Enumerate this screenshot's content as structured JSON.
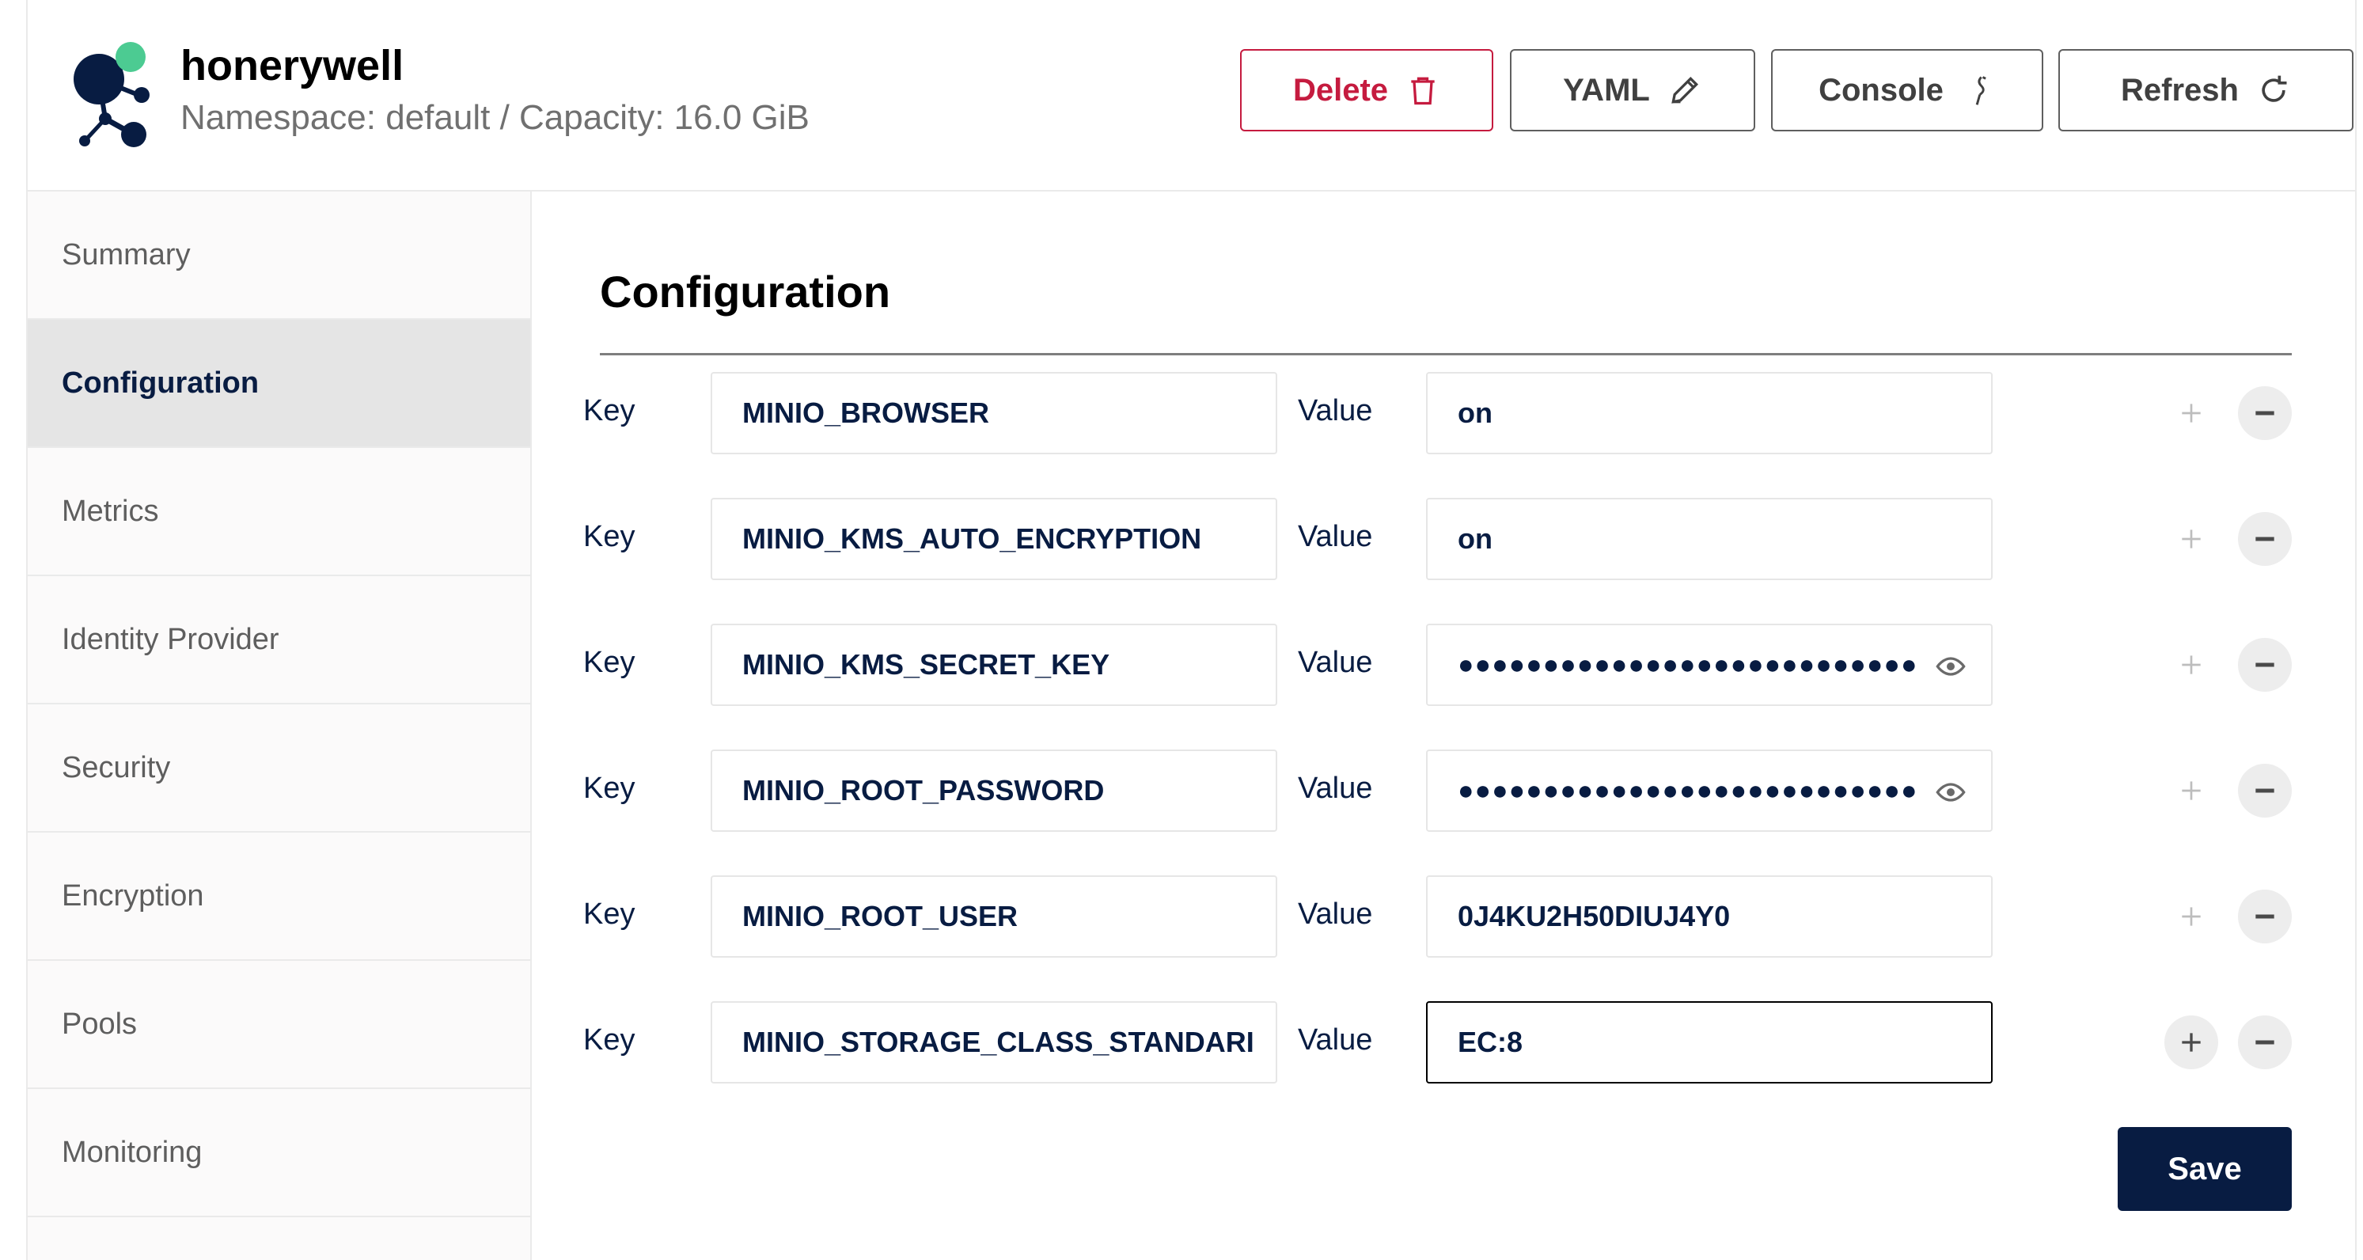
{
  "header": {
    "tenant_name": "honerywell",
    "subtitle": "Namespace: default / Capacity: 16.0 GiB",
    "buttons": {
      "delete": "Delete",
      "yaml": "YAML",
      "console": "Console",
      "refresh": "Refresh"
    }
  },
  "colors": {
    "primary": "#081c42",
    "danger": "#c51b3f",
    "logo_dark": "#081c42",
    "logo_green": "#4ccb92"
  },
  "sidebar": {
    "items": [
      {
        "label": "Summary",
        "active": false
      },
      {
        "label": "Configuration",
        "active": true
      },
      {
        "label": "Metrics",
        "active": false
      },
      {
        "label": "Identity Provider",
        "active": false
      },
      {
        "label": "Security",
        "active": false
      },
      {
        "label": "Encryption",
        "active": false
      },
      {
        "label": "Pools",
        "active": false
      },
      {
        "label": "Monitoring",
        "active": false
      }
    ]
  },
  "main": {
    "title": "Configuration",
    "key_label": "Key",
    "value_label": "Value",
    "rows": [
      {
        "key": "MINIO_BROWSER",
        "value": "on",
        "masked": false
      },
      {
        "key": "MINIO_KMS_AUTO_ENCRYPTION",
        "value": "on",
        "masked": false
      },
      {
        "key": "MINIO_KMS_SECRET_KEY",
        "value": "●●●●●●●●●●●●●●●●●●●●●●●●●●●●●●●●",
        "masked": true
      },
      {
        "key": "MINIO_ROOT_PASSWORD",
        "value": "●●●●●●●●●●●●●●●●●●●●●●●●●●●●●●●●",
        "masked": true
      },
      {
        "key": "MINIO_ROOT_USER",
        "value": "0J4KU2H50DIUJ4Y0",
        "masked": false
      },
      {
        "key": "MINIO_STORAGE_CLASS_STANDARI",
        "value": "EC:8",
        "masked": false,
        "focused": true
      }
    ],
    "save_label": "Save"
  },
  "icons": [
    "trash-icon",
    "pencil-icon",
    "console-icon",
    "refresh-icon",
    "eye-icon",
    "plus-icon",
    "minus-icon",
    "tenant-logo"
  ]
}
